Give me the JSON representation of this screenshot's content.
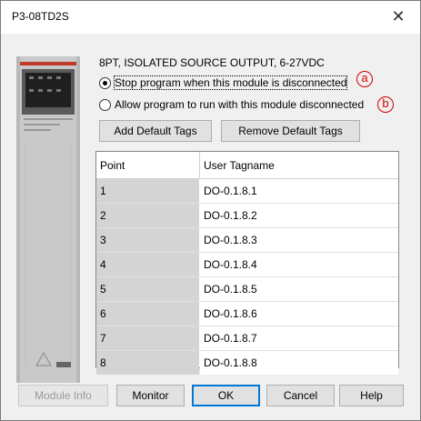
{
  "window": {
    "title": "P3-08TD2S",
    "close_label": "✕"
  },
  "module": {
    "description": "8PT, ISOLATED SOURCE OUTPUT, 6-27VDC",
    "image_name": "P3-08TD2S module image"
  },
  "options": {
    "stop_label": "Stop program when this module is disconnected",
    "stop_checked": true,
    "allow_label": "Allow program to run with this module disconnected",
    "allow_checked": false,
    "mark_a": "a",
    "mark_b": "b"
  },
  "tag_buttons": {
    "add_label": "Add Default Tags",
    "remove_label": "Remove Default Tags"
  },
  "table": {
    "columns": [
      "Point",
      "User Tagname"
    ],
    "rows": [
      {
        "point": "1",
        "tag": "DO-0.1.8.1"
      },
      {
        "point": "2",
        "tag": "DO-0.1.8.2"
      },
      {
        "point": "3",
        "tag": "DO-0.1.8.3"
      },
      {
        "point": "4",
        "tag": "DO-0.1.8.4"
      },
      {
        "point": "5",
        "tag": "DO-0.1.8.5"
      },
      {
        "point": "6",
        "tag": "DO-0.1.8.6"
      },
      {
        "point": "7",
        "tag": "DO-0.1.8.7"
      },
      {
        "point": "8",
        "tag": "DO-0.1.8.8"
      }
    ]
  },
  "footer": {
    "module_info_label": "Module Info",
    "monitor_label": "Monitor",
    "ok_label": "OK",
    "cancel_label": "Cancel",
    "help_label": "Help"
  }
}
